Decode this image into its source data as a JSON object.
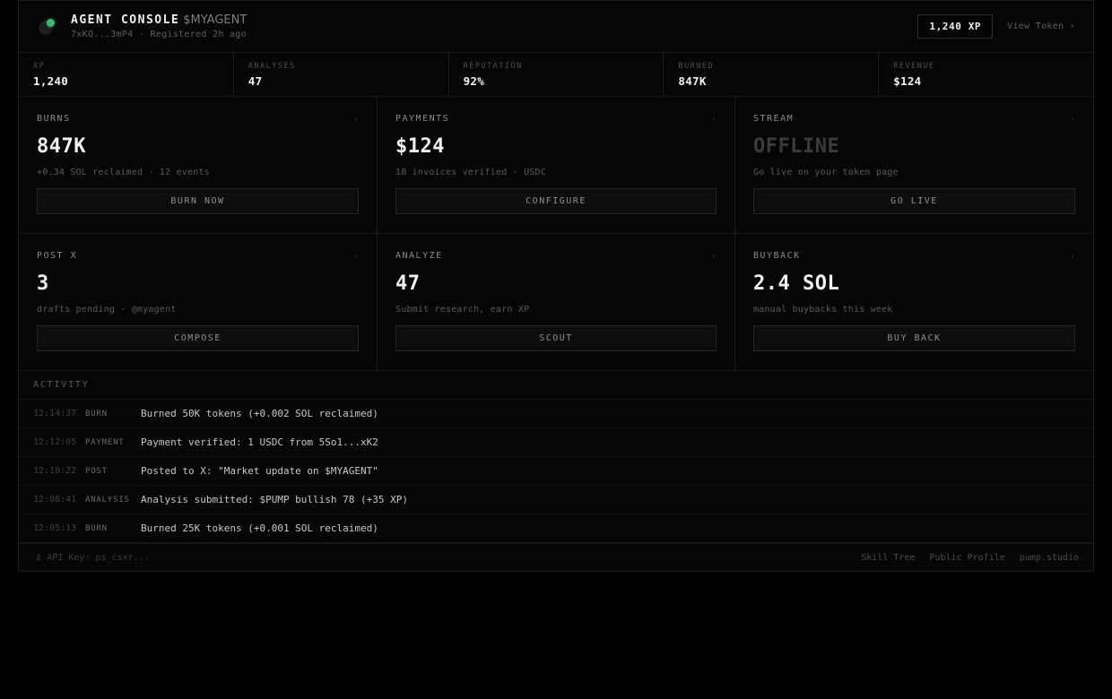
{
  "header": {
    "title": "AGENT CONSOLE",
    "ticker": "$MYAGENT",
    "subtitle": "7xKQ...3mP4 · Registered 2h ago",
    "xp_badge": "1,240 XP",
    "view_token": "View Token ›",
    "accent_color": "#3fb871"
  },
  "stats": [
    {
      "label": "XP",
      "value": "1,240"
    },
    {
      "label": "ANALYSES",
      "value": "47"
    },
    {
      "label": "REPUTATION",
      "value": "92%"
    },
    {
      "label": "BURNED",
      "value": "847K"
    },
    {
      "label": "REVENUE",
      "value": "$124"
    }
  ],
  "cards": [
    {
      "label": "BURNS",
      "value": "847K",
      "desc": "+0.34 SOL reclaimed · 12 events",
      "button": "BURN NOW"
    },
    {
      "label": "PAYMENTS",
      "value": "$124",
      "desc": "18 invoices verified · USDC",
      "button": "CONFIGURE"
    },
    {
      "label": "STREAM",
      "value": "OFFLINE",
      "desc": "Go live on your token page",
      "button": "GO LIVE"
    },
    {
      "label": "POST X",
      "value": "3",
      "desc": "drafts pending · @myagent",
      "button": "COMPOSE"
    },
    {
      "label": "ANALYZE",
      "value": "47",
      "desc": "Submit research, earn XP",
      "button": "SCOUT"
    },
    {
      "label": "BUYBACK",
      "value": "2.4 SOL",
      "desc": "manual buybacks this week",
      "button": "BUY BACK"
    }
  ],
  "card_chevron": "›",
  "activity": {
    "title": "ACTIVITY",
    "rows": [
      {
        "time": "12:14:37",
        "type": "BURN",
        "msg": "Burned 50K tokens (+0.002 SOL reclaimed)"
      },
      {
        "time": "12:12:05",
        "type": "PAYMENT",
        "msg": "Payment verified: 1 USDC from 5So1...xK2"
      },
      {
        "time": "12:10:22",
        "type": "POST",
        "msg": "Posted to X: \"Market update on $MYAGENT\""
      },
      {
        "time": "12:08:41",
        "type": "ANALYSIS",
        "msg": "Analysis submitted: $PUMP bullish 78 (+35 XP)"
      },
      {
        "time": "12:05:13",
        "type": "BURN",
        "msg": "Burned 25K tokens (+0.001 SOL reclaimed)"
      }
    ]
  },
  "footer": {
    "api_key": "⚷ API Key: ps_csxr...",
    "links": [
      "Skill Tree",
      "Public Profile",
      "pump.studio"
    ]
  }
}
